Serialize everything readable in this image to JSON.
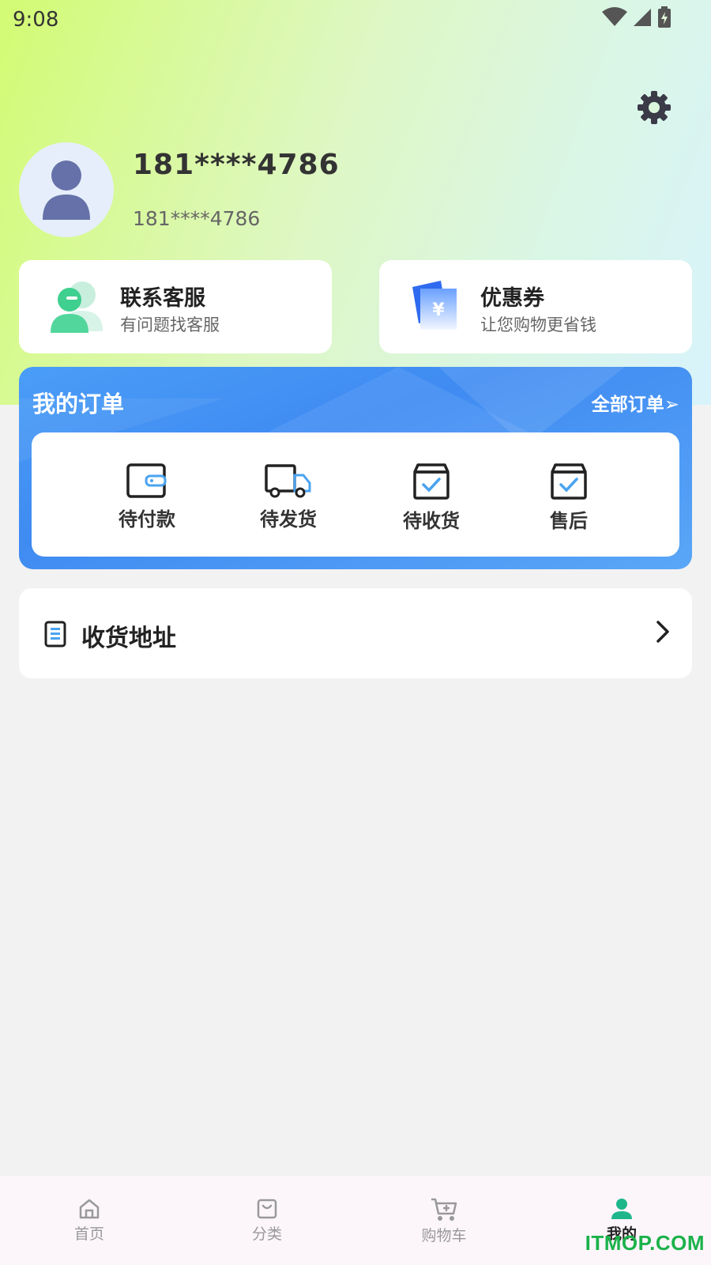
{
  "status_bar": {
    "time": "9:08"
  },
  "profile": {
    "name": "181****4786",
    "subtitle": "181****4786"
  },
  "cards": {
    "service": {
      "title": "联系客服",
      "subtitle": "有问题找客服"
    },
    "coupon": {
      "title": "优惠券",
      "subtitle": "让您购物更省钱"
    }
  },
  "orders": {
    "title": "我的订单",
    "all_label": "全部订单➢",
    "items": [
      {
        "label": "待付款",
        "icon": "wallet-icon"
      },
      {
        "label": "待发货",
        "icon": "truck-icon"
      },
      {
        "label": "待收货",
        "icon": "box-check-icon"
      },
      {
        "label": "售后",
        "icon": "box-check-icon"
      }
    ]
  },
  "address": {
    "label": "收货地址"
  },
  "tabbar": {
    "items": [
      {
        "label": "首页",
        "icon": "home-icon"
      },
      {
        "label": "分类",
        "icon": "bag-icon"
      },
      {
        "label": "购物车",
        "icon": "cart-icon"
      },
      {
        "label": "我的",
        "icon": "user-icon",
        "active": true
      }
    ]
  },
  "watermark": "ITMOP.COM",
  "colors": {
    "accent_blue": "#3f8bf2",
    "active_tab": "#1db68a",
    "watermark": "#1bb24a"
  }
}
